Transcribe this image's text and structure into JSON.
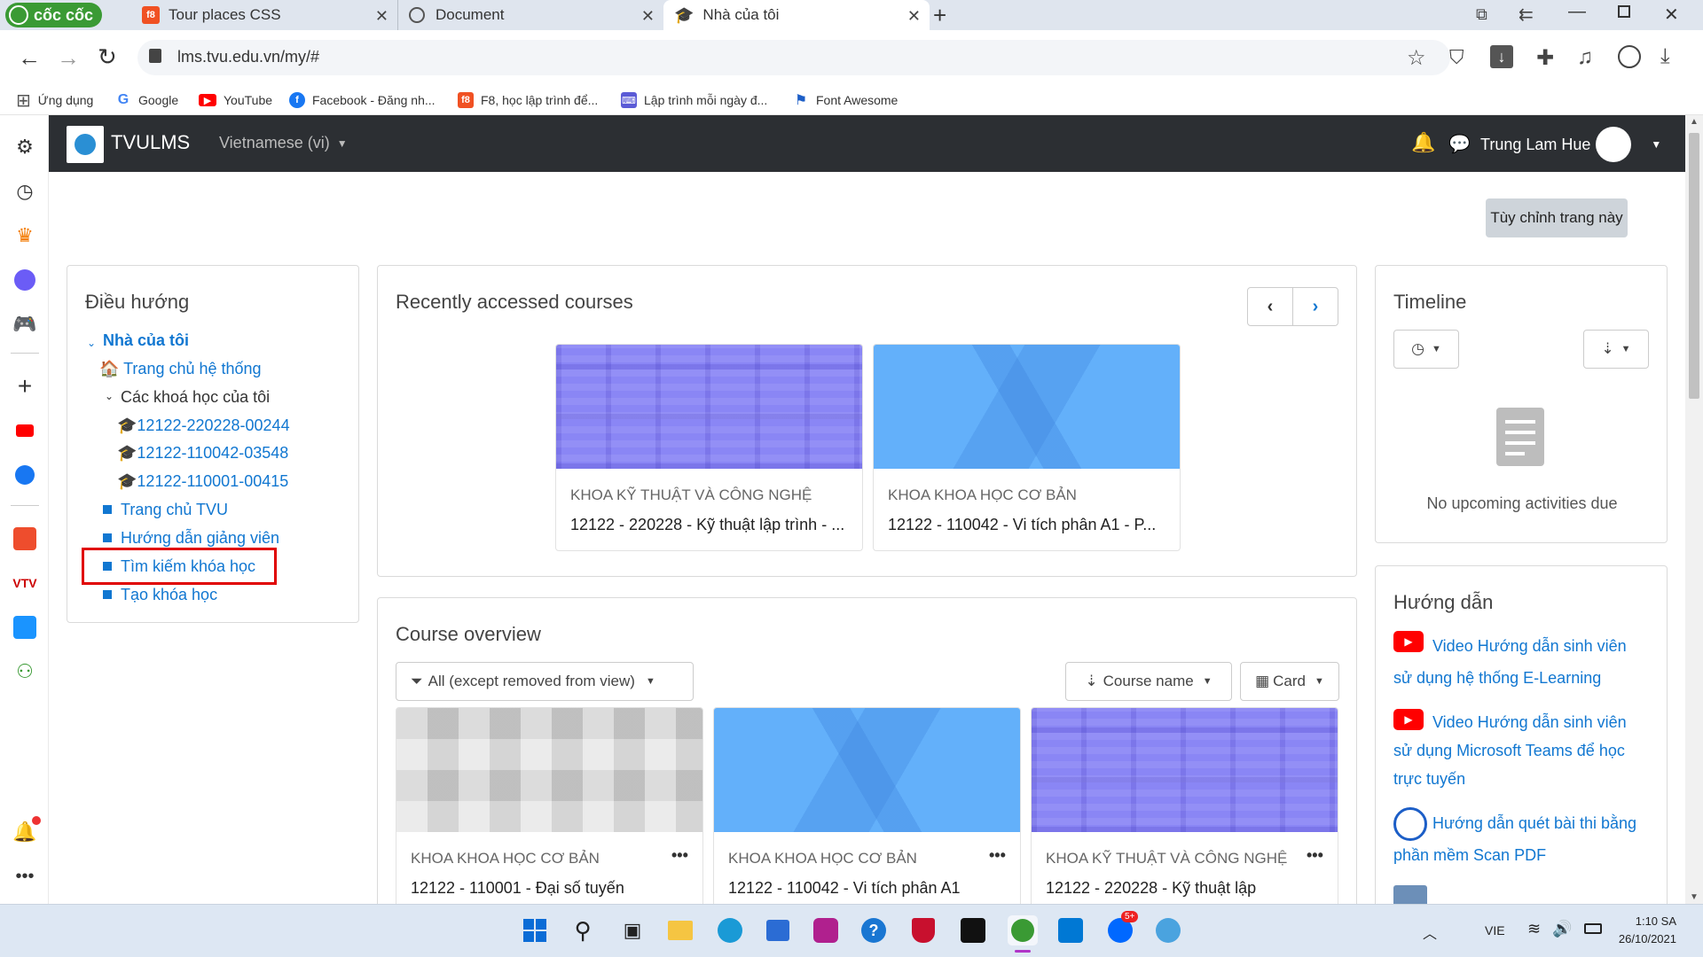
{
  "browser": {
    "brand": "cốc cốc",
    "tabs": [
      {
        "title": "Tour places CSS",
        "favicon": "f8"
      },
      {
        "title": "Document"
      },
      {
        "title": "Nhà của tôi"
      }
    ],
    "url": "lms.tvu.edu.vn/my/#",
    "bookmarks": [
      {
        "label": "Ứng dụng",
        "icon": "apps-grid-icon"
      },
      {
        "label": "Google",
        "icon": "G",
        "color": "#4285f4"
      },
      {
        "label": "YouTube",
        "icon": "youtube-icon",
        "color": "#ff0000"
      },
      {
        "label": "Facebook - Đăng nh...",
        "icon": "f",
        "color": "#1877f2"
      },
      {
        "label": "F8, học lập trình để...",
        "icon": "f8",
        "color": "#f05123"
      },
      {
        "label": "Lập trình mỗi ngày đ...",
        "icon": "code-icon",
        "color": "#5b5bd6"
      },
      {
        "label": "Font Awesome",
        "icon": "flag-icon",
        "color": "#1c5ec7"
      }
    ]
  },
  "header": {
    "site_name": "TVULMS",
    "language": "Vietnamese (vi)",
    "user_name": "Trung Lam Hue"
  },
  "page": {
    "customise_button": "Tùy chỉnh trang này"
  },
  "navigation": {
    "title": "Điều hướng",
    "home": "Nhà của tôi",
    "site_home": "Trang chủ hệ thống",
    "my_courses": "Các khoá học của tôi",
    "courses": [
      "12122-220228-00244",
      "12122-110042-03548",
      "12122-110001-00415"
    ],
    "links": [
      "Trang chủ TVU",
      "Hướng dẫn giảng viên",
      "Tìm kiếm khóa học",
      "Tạo khóa học"
    ]
  },
  "recent": {
    "title": "Recently accessed courses",
    "courses": [
      {
        "category": "KHOA KỸ THUẬT VÀ CÔNG NGHỆ",
        "name": "12122 - 220228 - Kỹ thuật lập trình - ..."
      },
      {
        "category": "KHOA KHOA HỌC CƠ BẢN",
        "name": "12122 - 110042 - Vi tích phân A1 - P..."
      }
    ]
  },
  "overview": {
    "title": "Course overview",
    "filter": "All (except removed from view)",
    "sort": "Course name",
    "view": "Card",
    "courses": [
      {
        "category": "KHOA KHOA HỌC CƠ BẢN",
        "name": "12122 - 110001 - Đại số tuyến"
      },
      {
        "category": "KHOA KHOA HỌC CƠ BẢN",
        "name": "12122 - 110042 - Vi tích phân A1"
      },
      {
        "category": "KHOA KỸ THUẬT VÀ CÔNG NGHỆ",
        "name": "12122 - 220228 - Kỹ thuật lập"
      }
    ]
  },
  "timeline": {
    "title": "Timeline",
    "empty": "No upcoming activities due"
  },
  "guide": {
    "title": "Hướng dẫn",
    "items": [
      {
        "line1": "Video Hướng dẫn sinh viên",
        "line2": "sử dụng hệ thống E-Learning",
        "line3": ""
      },
      {
        "line1": "Video Hướng dẫn sinh viên",
        "line2": "sử dụng Microsoft Teams để học",
        "line3": "trực tuyến"
      },
      {
        "line1": "Hướng dẫn quét bài thi bằng",
        "line2": "phần mềm Scan PDF",
        "line3": ""
      }
    ]
  },
  "system": {
    "language": "VIE",
    "time": "1:10 SA",
    "date": "26/10/2021",
    "zalo_badge": "5+"
  },
  "colors": {
    "link": "#1177d1",
    "header_bg": "#2c2f33",
    "highlight_box": "#e00000"
  }
}
